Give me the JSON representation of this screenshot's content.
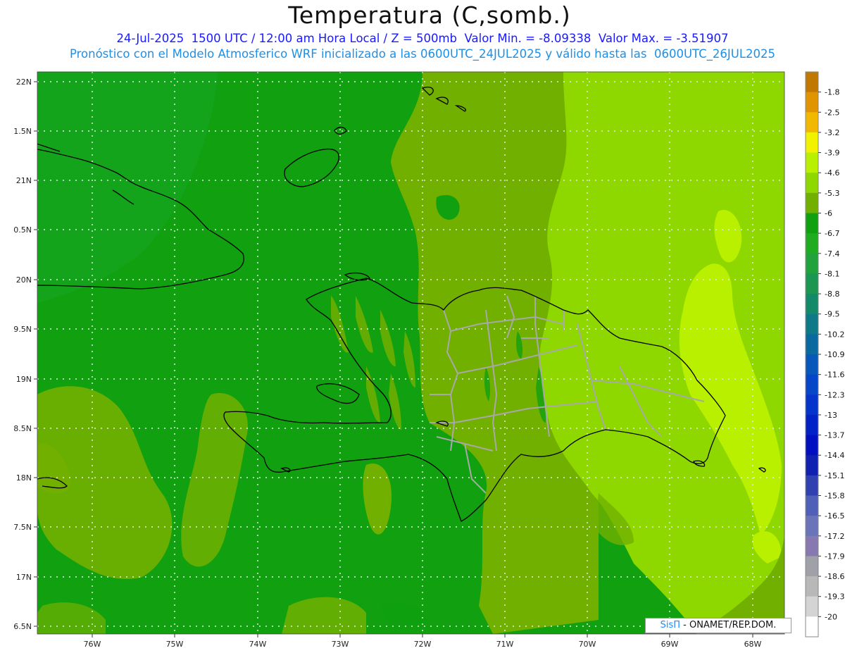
{
  "title": "Temperatura (C,somb.)",
  "subtitle_line1": "24-Jul-2025  1500 UTC / 12:00 am Hora Local / Z = 500mb  Valor Min. = -8.09338  Valor Max. = -3.51907",
  "subtitle_line2": "Pronóstico con el Modelo Atmosferico WRF inicializado a las 0600UTC_24JUL2025 y válido hasta las  0600UTC_26JUL2025",
  "colors": {
    "subtitle_line1": "#1a1aff",
    "subtitle_line2": "#1f8fe6",
    "coastline": "#000000",
    "province_borders": "#a8a8a8"
  },
  "map": {
    "lat_labels": [
      "22N",
      "1.5N",
      "21N",
      "0.5N",
      "20N",
      "9.5N",
      "19N",
      "8.5N",
      "18N",
      "7.5N",
      "17N",
      "6.5N"
    ],
    "lon_labels": [
      "76W",
      "75W",
      "74W",
      "73W",
      "72W",
      "71W",
      "70W",
      "69W",
      "68W"
    ],
    "lat_range": [
      16.5,
      22.1
    ],
    "lon_range": [
      -76.6,
      -67.6
    ],
    "grid": "dotted"
  },
  "colorbar": {
    "labels": [
      "-1.8",
      "-2.5",
      "-3.2",
      "-3.9",
      "-4.6",
      "-5.3",
      "-6",
      "-6.7",
      "-7.4",
      "-8.1",
      "-8.8",
      "-9.5",
      "-10.2",
      "-10.9",
      "-11.6",
      "-12.3",
      "-13",
      "-13.7",
      "-14.4",
      "-15.1",
      "-15.8",
      "-16.5",
      "-17.2",
      "-17.9",
      "-18.6",
      "-19.3",
      "-20"
    ],
    "colors": [
      "#c07800",
      "#e09400",
      "#f2b800",
      "#f2f200",
      "#b8f000",
      "#8ed800",
      "#72b000",
      "#10a010",
      "#20ac20",
      "#22a23a",
      "#1c9650",
      "#148a6a",
      "#0e7a88",
      "#0a6aa0",
      "#0858bc",
      "#0646c8",
      "#0434cc",
      "#0222c8",
      "#0010c0",
      "#1020b0",
      "#3040b0",
      "#5060b8",
      "#6a74b8",
      "#8878b0",
      "#a0a0a8",
      "#b8b8b8",
      "#d4d4d4",
      "#ffffff"
    ]
  },
  "credit": {
    "sis": "SisΠ",
    "rest": " - ONAMET/REP.DOM."
  }
}
